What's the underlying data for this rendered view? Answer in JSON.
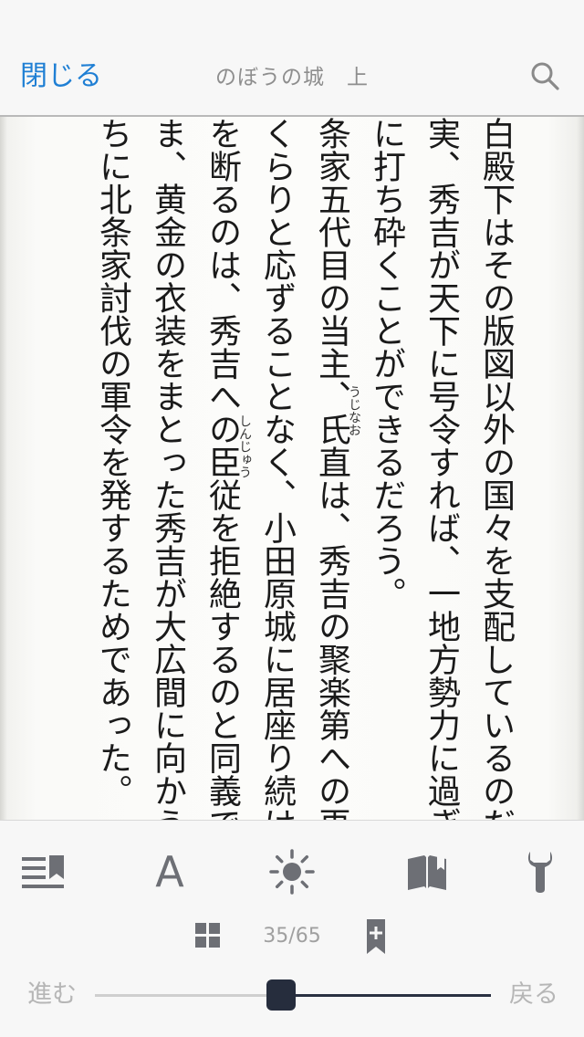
{
  "nav": {
    "close_label": "閉じる",
    "title": "のぼうの城　上"
  },
  "content": {
    "columns": [
      "白殿下はその版図以外の国々を支配しているのだ）",
      "実、秀吉が天下に号令すれば、一地方勢力に過ぎぬ北",
      "に打ち砕くことができるだろう。",
      "条家五代目の当主、氏直は、秀吉の聚楽第への再三の",
      "くらりと応ずることなく、小田原城に居座り続けた。",
      "を断るのは、秀吉への臣従を拒絶するのと同義である",
      "ま、黄金の衣装をまとった秀吉が大広間に向かうのは",
      "ちに北条家討伐の軍令を発するためであった。"
    ],
    "ruby": {
      "ujinao": "うじなお",
      "shinjuu": "しんじゅう"
    }
  },
  "toolbar": {
    "font_letter": "A",
    "page_indicator": "35/65",
    "slider_forward": "進む",
    "slider_back": "戻る",
    "progress": 0.54
  },
  "icons": {
    "search": "search-icon",
    "toc": "table-of-contents-icon",
    "font": "font-size-icon",
    "brightness": "brightness-icon",
    "bookmarks": "bookmarks-book-icon",
    "settings": "wrench-icon",
    "grid": "grid-icon",
    "bookmark_add": "bookmark-add-icon"
  },
  "colors": {
    "accent": "#1f7fd4",
    "icon_gray": "#6d6f75",
    "slider_dark": "#262d3d"
  }
}
